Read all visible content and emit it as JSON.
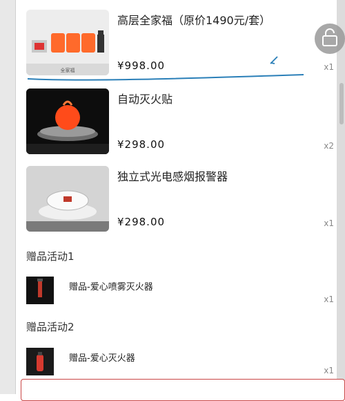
{
  "products": [
    {
      "title": "高层全家福（原价1490元/套）",
      "price": "¥998.00",
      "qty": "x1",
      "thumb_icon": "family-pack-icon",
      "thumb_caption": "全家福"
    },
    {
      "title": "自动灭火贴",
      "price": "¥298.00",
      "qty": "x2",
      "thumb_icon": "fire-extinguisher-sticker-icon"
    },
    {
      "title": "独立式光电感烟报警器",
      "price": "¥298.00",
      "qty": "x1",
      "thumb_icon": "smoke-detector-icon"
    }
  ],
  "gift_activities": [
    {
      "title": "赠品活动1",
      "gift_name": "赠品-爱心喷雾灭火器",
      "qty": "x1",
      "icon": "spray-extinguisher-icon"
    },
    {
      "title": "赠品活动2",
      "gift_name": "赠品-爱心灭火器",
      "qty": "x1",
      "icon": "extinguisher-icon"
    }
  ],
  "colors": {
    "accent_red": "#c94545",
    "annotation_blue": "#2a7fb8"
  }
}
